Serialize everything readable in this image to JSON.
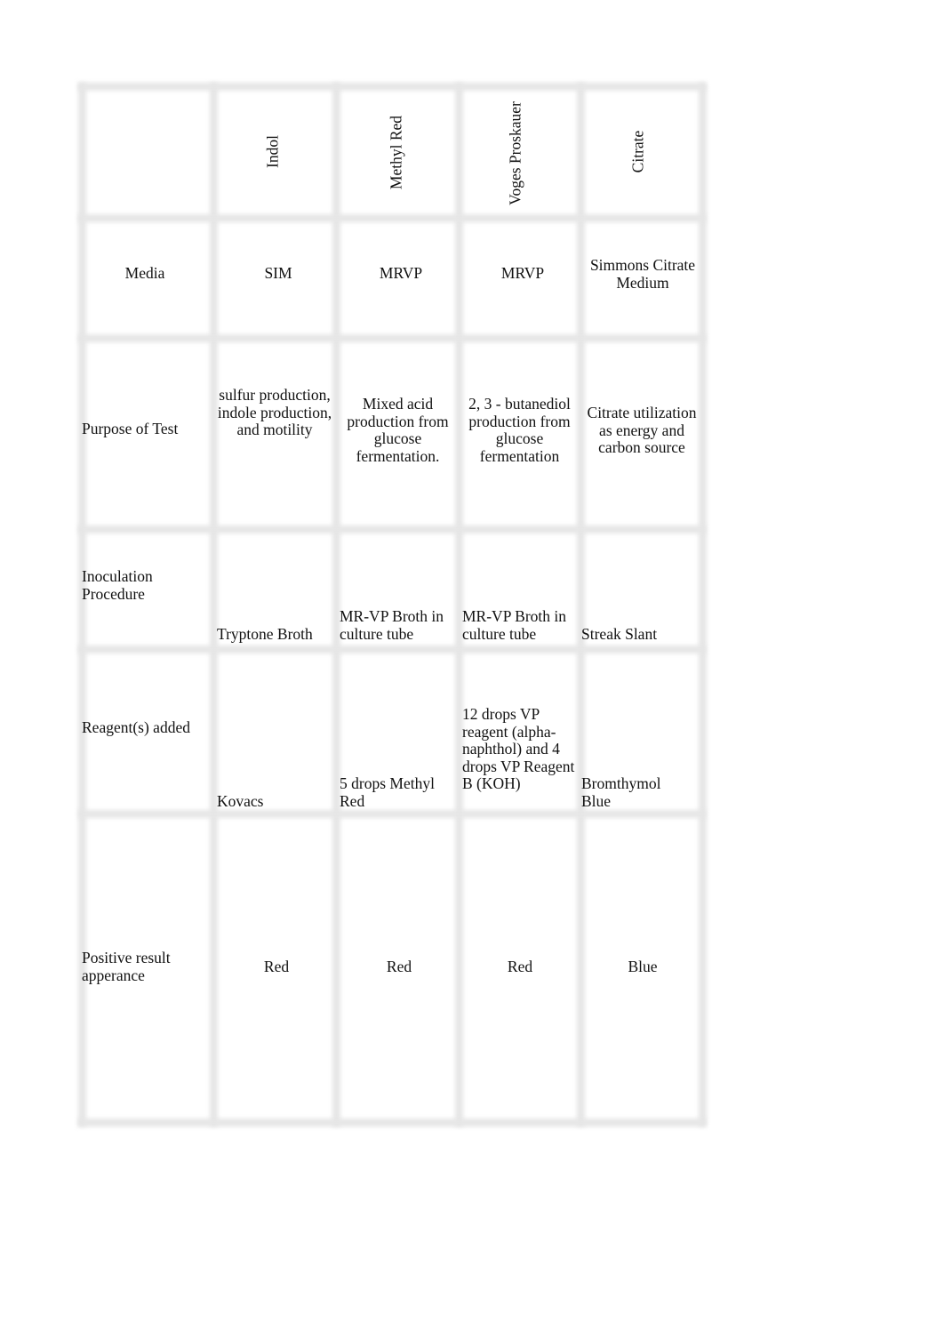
{
  "table": {
    "header": [
      "",
      "Indol",
      "Methyl Red",
      "Voges Proskauer",
      "Citrate"
    ],
    "rows": [
      {
        "label": "Media",
        "cells": [
          "SIM",
          "MRVP",
          "MRVP",
          "Simmons Citrate Medium"
        ]
      },
      {
        "label": "Purpose of Test",
        "cells": [
          "sulfur production, indole production, and motility",
          "Mixed acid production from glucose fermentation.",
          "2, 3 - butanediol production from glucose fermentation",
          "Citrate utilization as energy and carbon source"
        ]
      },
      {
        "label": "Inoculation Procedure",
        "cells": [
          "Tryptone Broth",
          "MR-VP Broth in culture tube",
          "MR-VP Broth in culture tube",
          "Streak Slant"
        ]
      },
      {
        "label": "Reagent(s) added",
        "cells": [
          "Kovacs",
          "5 drops Methyl Red",
          "12 drops VP reagent (alpha-naphthol) and 4 drops VP Reagent B (KOH)",
          "Bromthymol Blue"
        ]
      },
      {
        "label": "Positive result apperance",
        "cells": [
          "Red",
          "Red",
          "Red",
          "Blue"
        ]
      }
    ]
  }
}
